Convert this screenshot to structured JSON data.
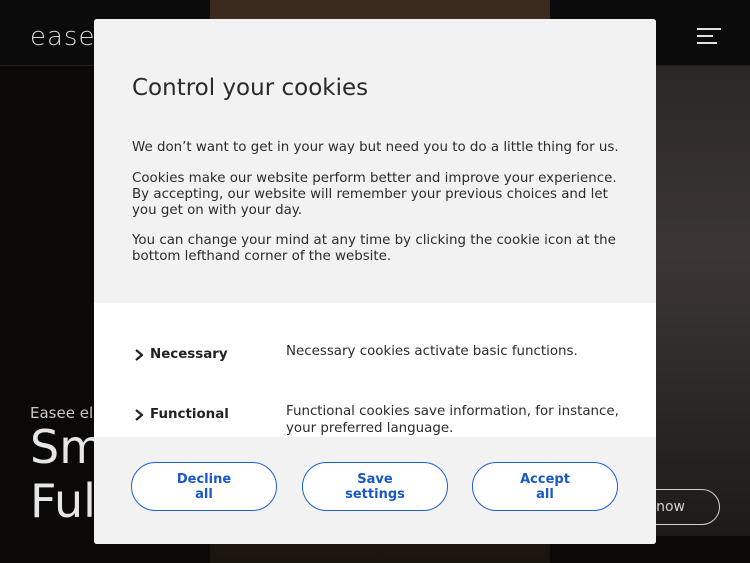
{
  "background": {
    "logo": "easee",
    "eyebrow": "Easee el",
    "headline_line1": "Sm",
    "headline_line2": "Ful",
    "cta_label": "now"
  },
  "dialog": {
    "title": "Control your cookies",
    "paragraph1": "We don’t want to get in your way but need you to do a little thing for us.",
    "paragraph2": "Cookies make our website perform better and improve your experience. By accepting, our website will remember your previous choices and let you get on with your day.",
    "paragraph3": "You can change your mind at any time by clicking the cookie icon at the bottom lefthand corner of the website.",
    "categories": [
      {
        "name": "Necessary",
        "description": "Necessary cookies activate basic functions."
      },
      {
        "name": "Functional",
        "description": "Functional cookies save information, for instance, your preferred language."
      }
    ],
    "buttons": {
      "decline": "Decline all",
      "save": "Save settings",
      "accept": "Accept all"
    }
  },
  "colors": {
    "accent": "#1f5fd4",
    "panel_gray": "#f2f2f2",
    "text": "#2b2b2b"
  }
}
